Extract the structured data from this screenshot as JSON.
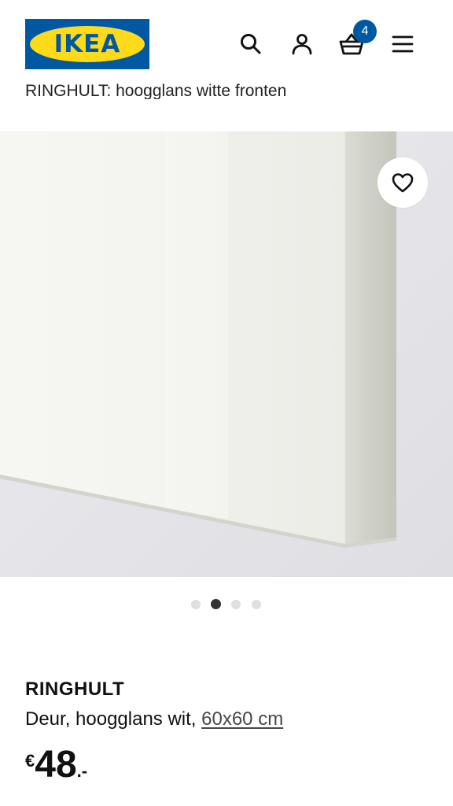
{
  "header": {
    "logo_text": "IKEA",
    "logo_reg": "®",
    "icons": [
      "search-icon",
      "account-icon",
      "basket-icon",
      "menu-icon"
    ],
    "cart_count": "4"
  },
  "breadcrumb_subtitle": "RINGHULT: hoogglans witte fronten",
  "gallery": {
    "image_count": 4,
    "active_index": 1,
    "favourite_icon": "heart-icon"
  },
  "product": {
    "name": "RINGHULT",
    "description": "Deur, hoogglans wit,",
    "size_link": "60x60 cm",
    "price_currency": "€",
    "price_amount": "48",
    "price_decimals": ".-"
  },
  "colors": {
    "brand_blue": "#0058a3",
    "brand_yellow": "#ffda1a"
  }
}
